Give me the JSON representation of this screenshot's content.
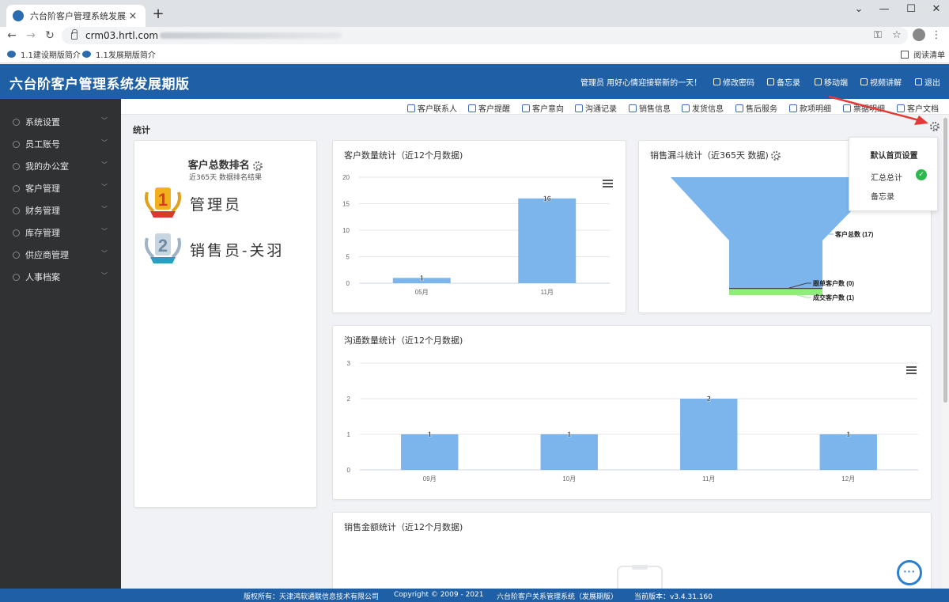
{
  "browser": {
    "tab_title": "六台阶客户管理系统发展期版",
    "tab_close": "×",
    "new_tab": "+",
    "url": "crm03.hrtl.com",
    "bookmarks": [
      "1.1建设期版简介",
      "1.1发展期版简介"
    ],
    "reading_list": "阅读清单",
    "window_controls": [
      "⌄",
      "—",
      "☐",
      "✕"
    ]
  },
  "header": {
    "title": "六台阶客户管理系统发展期版",
    "greeting": "管理员 用好心情迎接崭新的一天！",
    "links": [
      "修改密码",
      "备忘录",
      "移动端",
      "视频讲解",
      "退出"
    ]
  },
  "sidebar": {
    "items": [
      "系统设置",
      "员工账号",
      "我的办公室",
      "客户管理",
      "财务管理",
      "库存管理",
      "供应商管理",
      "人事档案"
    ]
  },
  "quickbar": {
    "items": [
      "客户联系人",
      "客户提醒",
      "客户意向",
      "沟通记录",
      "销售信息",
      "发货信息",
      "售后服务",
      "款项明细",
      "票据明细",
      "客户文档"
    ]
  },
  "section_label": "统计",
  "ranking": {
    "title": "客户总数排名",
    "subtitle": "近365天 数据排名结果",
    "entries": [
      {
        "rank": "1",
        "name": "管理员"
      },
      {
        "rank": "2",
        "name": "销售员-关羽"
      }
    ]
  },
  "settings_menu": {
    "title": "默认首页设置",
    "items": [
      "汇总总计",
      "备忘录"
    ],
    "selected": "汇总总计"
  },
  "chart_data": [
    {
      "type": "bar",
      "title": "客户数量统计（近12个月数据)",
      "categories": [
        "05月",
        "11月"
      ],
      "values": [
        1,
        16
      ],
      "ylim": [
        0,
        20
      ],
      "yticks": [
        0,
        5,
        10,
        15,
        20
      ],
      "color": "#7cb5ec"
    },
    {
      "type": "funnel",
      "title": "销售漏斗统计（近365天 数据)",
      "stages": [
        {
          "label": "客户总数 (17)",
          "value": 17,
          "color": "#7cb5ec"
        },
        {
          "label": "跟单客户数 (0)",
          "value": 0,
          "color": "#434348"
        },
        {
          "label": "成交客户数 (1)",
          "value": 1,
          "color": "#90ed7d"
        }
      ]
    },
    {
      "type": "bar",
      "title": "沟通数量统计（近12个月数据)",
      "categories": [
        "09月",
        "10月",
        "11月",
        "12月"
      ],
      "values": [
        1,
        1,
        2,
        1
      ],
      "ylim": [
        0,
        3
      ],
      "yticks": [
        0,
        1,
        2,
        3
      ],
      "color": "#7cb5ec"
    },
    {
      "type": "bar",
      "title": "销售金额统计（近12个月数据)",
      "categories": [],
      "values": []
    }
  ],
  "footer": {
    "copyright_owner": "版权所有：天津鸿软通联信息技术有限公司",
    "copyright": "Copyright © 2009 - 2021",
    "product": "六台阶客户关系管理系统（发展期版）",
    "version": "当前版本：v3.4.31.160"
  }
}
